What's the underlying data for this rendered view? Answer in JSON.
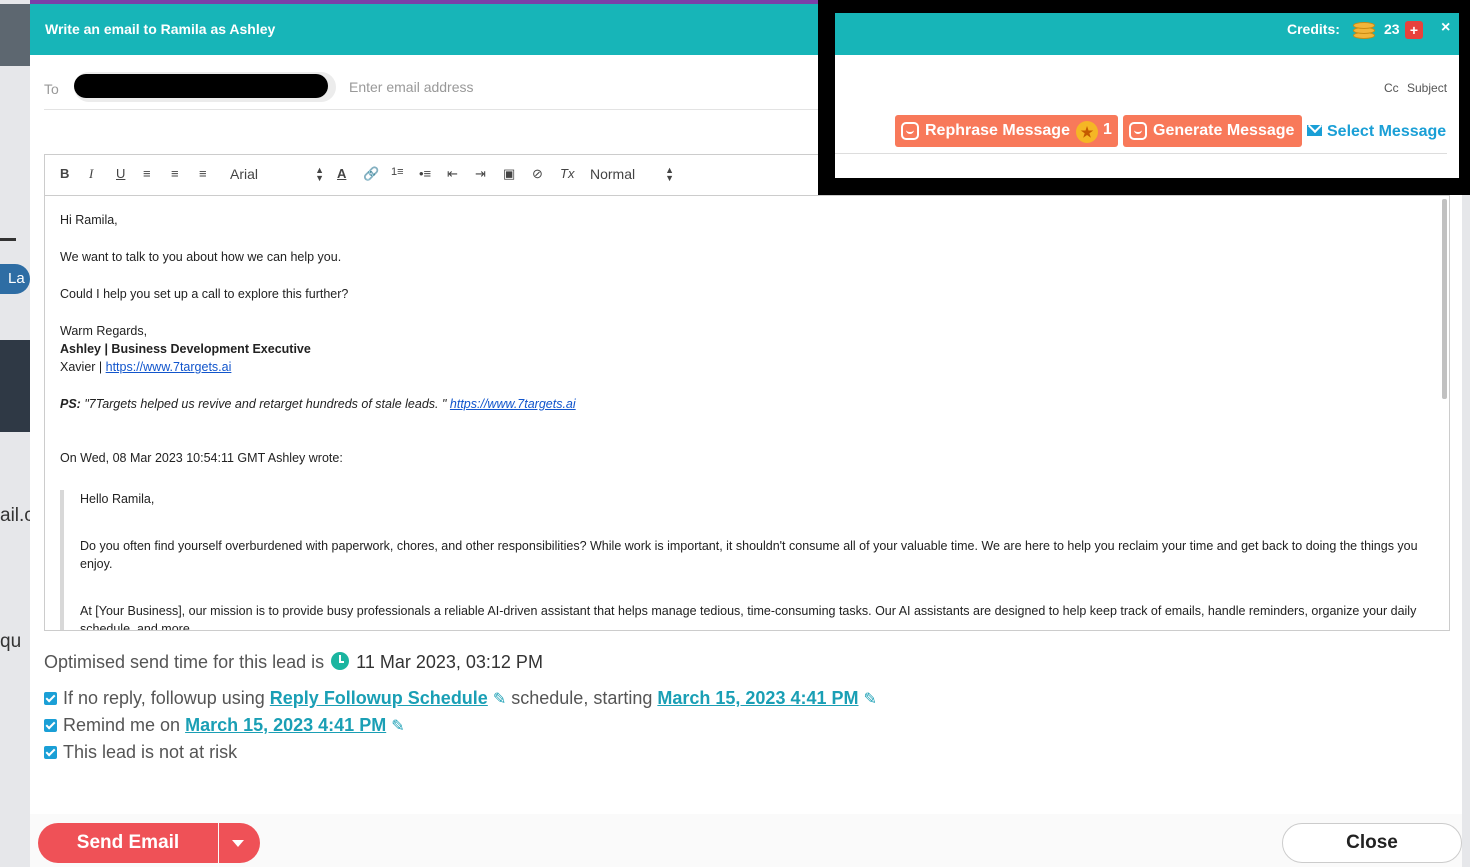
{
  "modal": {
    "title": "Write an email to Ramila as Ashley"
  },
  "to_row": {
    "label": "To",
    "placeholder": "Enter email address"
  },
  "toolbar": {
    "bold": "B",
    "italic": "I",
    "underline": "U",
    "font": "Arial",
    "size": "Normal",
    "clear": "Tx"
  },
  "email": {
    "greeting": "Hi Ramila,",
    "line1": "We want to talk to you about how we can help you.",
    "line2": "Could I help you set up a call to explore this further?",
    "regards": "Warm Regards,",
    "signature_name": "Ashley | Business Development Executive",
    "signature_company": "Xavier | ",
    "signature_link": "https://www.7targets.ai",
    "ps_label": "PS:",
    "ps_text": " \"7Targets helped us revive and retarget hundreds of stale leads. \" ",
    "ps_link": "https://www.7targets.ai",
    "quote_header": "On Wed, 08 Mar 2023 10:54:11 GMT Ashley wrote:",
    "quote_greeting": "Hello Ramila,",
    "quote_para1": "Do you often find yourself overburdened with paperwork, chores, and other responsibilities? While work is important, it shouldn't consume all of your valuable time. We are here to help you reclaim your time and get back to doing the things you enjoy.",
    "quote_para2": "At [Your Business], our mission is to provide busy professionals a reliable AI-driven assistant that helps manage tedious, time-consuming tasks. Our AI assistants are designed to help keep track of emails, handle reminders, organize your daily schedule, and more."
  },
  "optimised": {
    "label": "Optimised send time for this lead is",
    "datetime": "11 Mar 2023, 03:12 PM"
  },
  "followup": {
    "prefix": "If no reply, followup using",
    "schedule_link": "Reply Followup Schedule",
    "middle": "schedule, starting",
    "date_link": "March 15, 2023 4:41 PM"
  },
  "remind": {
    "prefix": "Remind me on",
    "date_link": "March 15, 2023 4:41 PM"
  },
  "risk": {
    "label": "This lead is not at risk"
  },
  "footer": {
    "send": "Send Email",
    "close": "Close"
  },
  "overlay": {
    "credits_label": "Credits:",
    "credits_value": "23",
    "plus": "+",
    "close": "×",
    "cc": "Cc",
    "subject": "Subject",
    "rephrase": "Rephrase Message",
    "rephrase_cost": "1",
    "generate": "Generate Message",
    "select": "Select Message"
  },
  "colors": {
    "header": "#17b5b8",
    "send": "#ef5157",
    "ai_button": "#f8795a",
    "link": "#1a9fb5"
  }
}
